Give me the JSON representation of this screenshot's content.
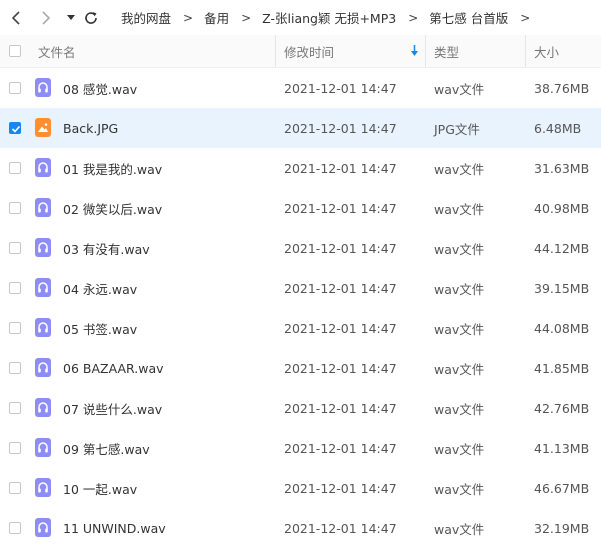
{
  "nav": {
    "back": "back-icon",
    "forward": "forward-icon",
    "dropdown": "dropdown-icon",
    "refresh": "refresh-icon"
  },
  "breadcrumb": [
    "我的网盘",
    "备用",
    "Z-张liang颖 无损+MP3",
    "第七感  台首版"
  ],
  "breadcrumb_separator": ">",
  "columns": {
    "name": "文件名",
    "modified": "修改时间",
    "type": "类型",
    "size": "大小"
  },
  "sort_indicator": "sort-down-icon",
  "colors": {
    "accent": "#1a84f2",
    "selected_row": "#e9f3fd",
    "audio_icon": "#8e8cf5",
    "image_icon": "#ff8f2e"
  },
  "files": [
    {
      "name": "08 感觉.wav",
      "modified": "2021-12-01 14:47",
      "type": "wav文件",
      "size": "38.76MB",
      "icon": "audio",
      "checked": false
    },
    {
      "name": "Back.JPG",
      "modified": "2021-12-01 14:47",
      "type": "JPG文件",
      "size": "6.48MB",
      "icon": "image",
      "checked": true
    },
    {
      "name": "01 我是我的.wav",
      "modified": "2021-12-01 14:47",
      "type": "wav文件",
      "size": "31.63MB",
      "icon": "audio",
      "checked": false
    },
    {
      "name": "02 微笑以后.wav",
      "modified": "2021-12-01 14:47",
      "type": "wav文件",
      "size": "40.98MB",
      "icon": "audio",
      "checked": false
    },
    {
      "name": "03 有没有.wav",
      "modified": "2021-12-01 14:47",
      "type": "wav文件",
      "size": "44.12MB",
      "icon": "audio",
      "checked": false
    },
    {
      "name": "04 永远.wav",
      "modified": "2021-12-01 14:47",
      "type": "wav文件",
      "size": "39.15MB",
      "icon": "audio",
      "checked": false
    },
    {
      "name": "05 书签.wav",
      "modified": "2021-12-01 14:47",
      "type": "wav文件",
      "size": "44.08MB",
      "icon": "audio",
      "checked": false
    },
    {
      "name": "06 BAZAAR.wav",
      "modified": "2021-12-01 14:47",
      "type": "wav文件",
      "size": "41.85MB",
      "icon": "audio",
      "checked": false
    },
    {
      "name": "07 说些什么.wav",
      "modified": "2021-12-01 14:47",
      "type": "wav文件",
      "size": "42.76MB",
      "icon": "audio",
      "checked": false
    },
    {
      "name": "09 第七感.wav",
      "modified": "2021-12-01 14:47",
      "type": "wav文件",
      "size": "41.13MB",
      "icon": "audio",
      "checked": false
    },
    {
      "name": "10 一起.wav",
      "modified": "2021-12-01 14:47",
      "type": "wav文件",
      "size": "46.67MB",
      "icon": "audio",
      "checked": false
    },
    {
      "name": "11 UNWIND.wav",
      "modified": "2021-12-01 14:47",
      "type": "wav文件",
      "size": "32.19MB",
      "icon": "audio",
      "checked": false
    }
  ]
}
